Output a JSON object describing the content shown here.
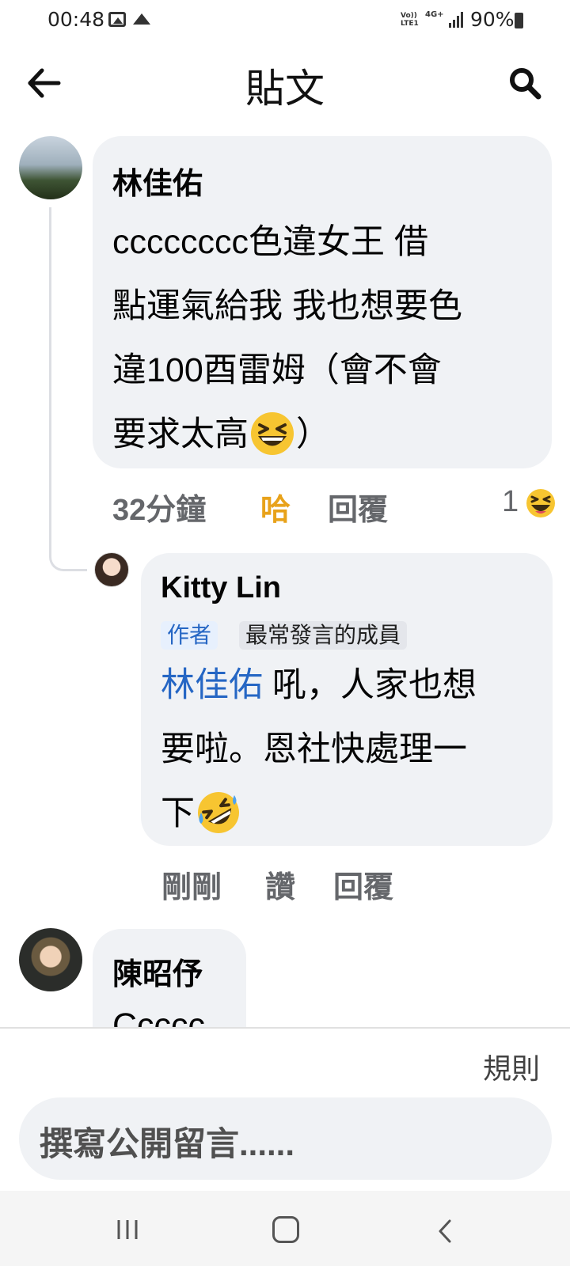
{
  "status_bar": {
    "time": "00:48",
    "network_volte": "Vo)) LTE1",
    "network_type": "4G+",
    "battery": "90%"
  },
  "header": {
    "title": "貼文"
  },
  "comments": [
    {
      "author": "林佳佑",
      "text_lines": [
        "cccccccc色違女王 借",
        "點運氣給我 我也想要色",
        "違100酉雷姆（會不會",
        "要求太高"
      ],
      "text_suffix": "）",
      "inline_emoji": "grinning-squinting-face",
      "time": "32分鐘",
      "reaction_label": "哈",
      "reply_label": "回覆",
      "reaction_count": "1",
      "reaction_icon": "haha-reaction-icon"
    },
    {
      "author": "Kitty Lin",
      "badges": [
        "作者",
        "最常發言的成員"
      ],
      "mention": "林佳佑",
      "text_line1": " 吼，人家也想",
      "text_line2": "要啦。恩社快處理一",
      "text_line3": "下",
      "inline_emoji": "rolling-on-floor-laughing",
      "time": "剛剛",
      "like_label": "讚",
      "reply_label": "回覆"
    },
    {
      "author": "陳昭伃",
      "partial_text": "Ccccc"
    }
  ],
  "composer": {
    "rules_label": "規則",
    "placeholder": "撰寫公開留言......"
  },
  "colors": {
    "bubble": "#f0f2f5",
    "mention": "#2566c4",
    "haha": "#e8a21a",
    "meta": "#65676b"
  }
}
